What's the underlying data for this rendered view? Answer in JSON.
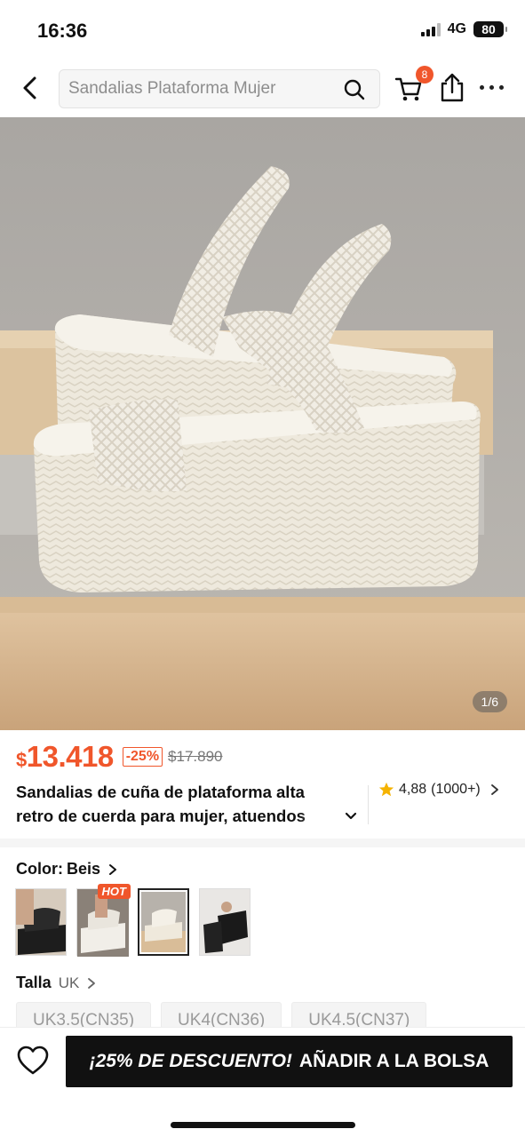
{
  "status": {
    "time": "16:36",
    "network": "4G",
    "battery": "80"
  },
  "search": {
    "placeholder": "Sandalias Plataforma Mujer"
  },
  "cart": {
    "badge": "8"
  },
  "gallery": {
    "pager": "1/6"
  },
  "product": {
    "currency": "$",
    "price": "13.418",
    "discount": "-25%",
    "original_price": "$17.890",
    "title_line1": "Sandalias de cuña de plataforma alta",
    "title_line2": "retro de cuerda para mujer, atuendos",
    "rating": "4,88",
    "reviews": "(1000+)"
  },
  "color": {
    "label": "Color:",
    "value": "Beis",
    "hot_badge": "HOT"
  },
  "size": {
    "label": "Talla",
    "unit": "UK",
    "options": [
      "UK3.5(CN35)",
      "UK4(CN36)",
      "UK4.5(CN37)"
    ]
  },
  "bottom": {
    "promo": "¡25% DE DESCUENTO!",
    "add_to_bag": "AÑADIR A LA BOLSA"
  },
  "colors": {
    "accent": "#f0562b",
    "dark": "#111111",
    "star": "#f5b301"
  }
}
